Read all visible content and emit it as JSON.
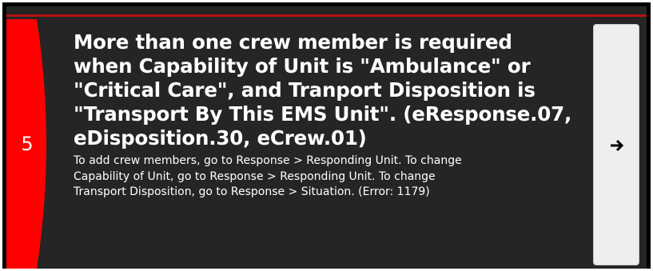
{
  "error_card": {
    "index": "5",
    "title": "More than one crew member is required when Capability of Unit is \"Ambulance\" or \"Critical Care\", and Tranport Disposition is \"Transport By This EMS Unit\". (eResponse.07, eDisposition.30, eCrew.01)",
    "detail": "To add crew members, go to Response > Responding Unit. To change Capability of Unit, go to Response > Responding Unit. To change Transport Disposition, go to Response > Situation. (Error: 1179)",
    "nav_icon": "arrow-right-icon"
  },
  "colors": {
    "badge": "#ff0000",
    "card_background": "#252525",
    "top_rule": "#b31212",
    "button_background": "#eeeeee"
  }
}
